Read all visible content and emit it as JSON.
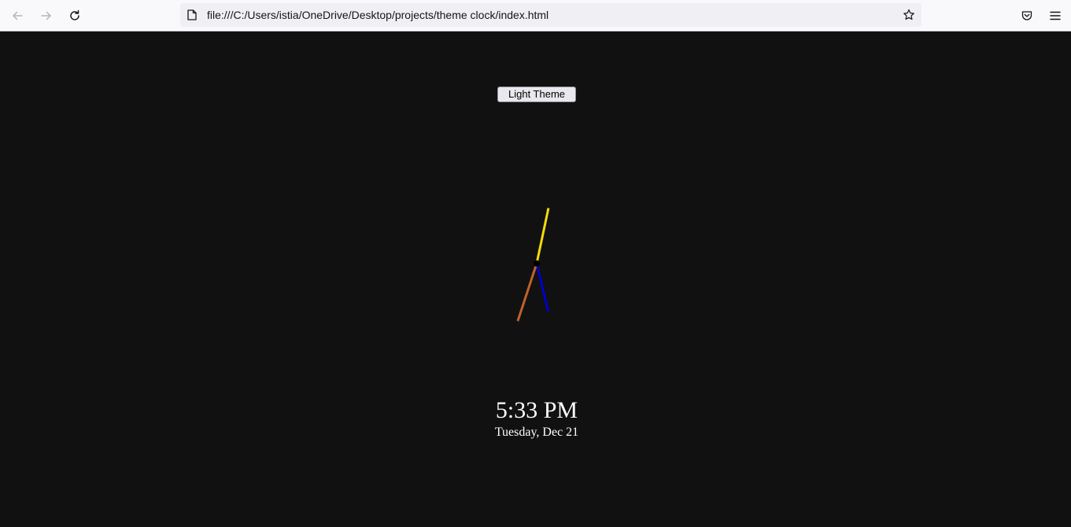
{
  "browser": {
    "url": "file:///C:/Users/istia/OneDrive/Desktop/projects/theme clock/index.html",
    "icons": {
      "back": "arrow-left-icon",
      "forward": "arrow-right-icon",
      "reload": "reload-icon",
      "page": "page-icon",
      "bookmark": "star-icon",
      "pocket": "pocket-icon",
      "menu": "hamburger-menu-icon"
    }
  },
  "page": {
    "theme_button_label": "Light Theme",
    "time": "5:33 PM",
    "date": "Tuesday, Dec 21",
    "background_color": "#111111"
  },
  "clock": {
    "hour": 17,
    "minute": 33,
    "second": 2,
    "colors": {
      "hour_hand": "#0000cc",
      "minute_hand": "#c0612b",
      "second_hand": "#f5d90a",
      "center": "#000000"
    }
  }
}
